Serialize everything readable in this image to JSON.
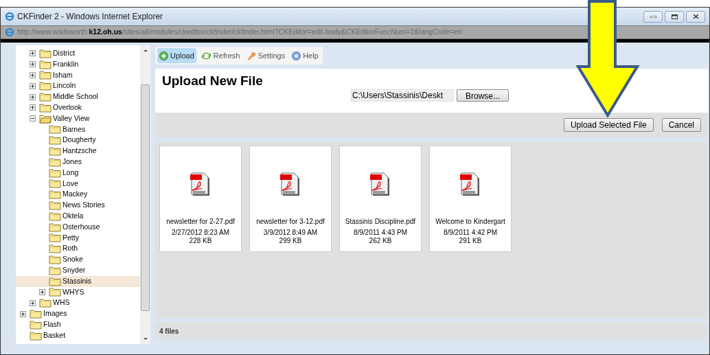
{
  "window": {
    "title": "CKFinder 2 - Windows Internet Explorer"
  },
  "address_bar": {
    "url": "http://www.wadsworth.**k12.oh.us**/sites/all/modules/ckeditor/ckfinder/ckfinder.html?CKEditor=edit-body&CKEditorFuncNum=2&langCode=en"
  },
  "tree": [
    {
      "kind": "hidden",
      "children": [
        {
          "kind": "branch",
          "label": "District",
          "expanded": false,
          "selected": false
        },
        {
          "kind": "branch",
          "label": "Franklin",
          "expanded": false,
          "selected": false
        },
        {
          "kind": "branch",
          "label": "Isham",
          "expanded": false,
          "selected": false
        },
        {
          "kind": "branch",
          "label": "Lincoln",
          "expanded": false,
          "selected": false
        },
        {
          "kind": "branch",
          "label": "Middle School",
          "expanded": false,
          "selected": false
        },
        {
          "kind": "branch",
          "label": "Overlook",
          "expanded": false,
          "selected": false
        },
        {
          "kind": "branch",
          "label": "Valley View",
          "expanded": true,
          "selected": false,
          "children": [
            {
              "kind": "leaf",
              "label": "Barnes",
              "selected": false
            },
            {
              "kind": "leaf",
              "label": "Dougherty",
              "selected": false
            },
            {
              "kind": "leaf",
              "label": "Hantzsche",
              "selected": false
            },
            {
              "kind": "leaf",
              "label": "Jones",
              "selected": false
            },
            {
              "kind": "leaf",
              "label": "Long",
              "selected": false
            },
            {
              "kind": "leaf",
              "label": "Love",
              "selected": false
            },
            {
              "kind": "leaf",
              "label": "Mackey",
              "selected": false
            },
            {
              "kind": "leaf",
              "label": "News Stories",
              "selected": false
            },
            {
              "kind": "leaf",
              "label": "Oktela",
              "selected": false
            },
            {
              "kind": "leaf",
              "label": "Osterhouse",
              "selected": false
            },
            {
              "kind": "leaf",
              "label": "Petty",
              "selected": false
            },
            {
              "kind": "leaf",
              "label": "Roth",
              "selected": false
            },
            {
              "kind": "leaf",
              "label": "Snoke",
              "selected": false
            },
            {
              "kind": "leaf",
              "label": "Snyder",
              "selected": false
            },
            {
              "kind": "leaf",
              "label": "Stassinis",
              "selected": true
            },
            {
              "kind": "branch",
              "label": "WHYS",
              "expanded": false,
              "selected": false
            }
          ]
        },
        {
          "kind": "branch",
          "label": "WHS",
          "expanded": false,
          "selected": false
        }
      ]
    },
    {
      "kind": "branch",
      "label": "Images",
      "expanded": false,
      "selected": false
    },
    {
      "kind": "leaf",
      "label": "Flash",
      "selected": false
    },
    {
      "kind": "leaf",
      "label": "Basket",
      "selected": false
    }
  ],
  "toolbar": [
    {
      "kind": "upload",
      "label": "Upload",
      "selected": true
    },
    {
      "kind": "refresh",
      "label": "Refresh",
      "selected": false
    },
    {
      "kind": "settings",
      "label": "Settings",
      "selected": false
    },
    {
      "kind": "help",
      "label": "Help",
      "selected": false
    }
  ],
  "upload_panel": {
    "title": "Upload New File",
    "file_path": "C:\\Users\\Stassinis\\Deskt",
    "browse_button": "Browse...",
    "upload_button": "Upload Selected File",
    "cancel_button": "Cancel"
  },
  "files": [
    {
      "name": "newsletter for 2-27.pdf",
      "date": "2/27/2012 8:23 AM",
      "size": "228 KB"
    },
    {
      "name": "newsletter for 3-12.pdf",
      "date": "3/9/2012 8:49 AM",
      "size": "299 KB"
    },
    {
      "name": "Stassinis Discipline.pdf",
      "date": "8/9/2011 4:43 PM",
      "size": "262 KB"
    },
    {
      "name": "Welcome to Kindergart",
      "date": "8/9/2011 4:42 PM",
      "size": "291 KB"
    }
  ],
  "status_bar": "4 files"
}
